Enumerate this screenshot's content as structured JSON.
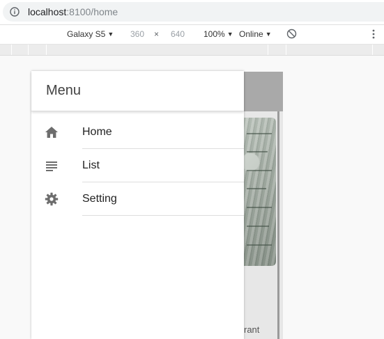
{
  "browser": {
    "url_host": "localhost",
    "url_rest": ":8100/home"
  },
  "device_toolbar": {
    "device": "Galaxy S5",
    "width": "360",
    "separator": "×",
    "height": "640",
    "zoom": "100%",
    "network": "Online"
  },
  "menu": {
    "title": "Menu",
    "items": [
      {
        "label": "Home",
        "icon": "home-icon"
      },
      {
        "label": "List",
        "icon": "list-icon"
      },
      {
        "label": "Setting",
        "icon": "settings-icon"
      }
    ]
  },
  "background_page": {
    "partial_text": "rant"
  },
  "colors": {
    "icon": "#6d6d6d",
    "header_gray": "#a9a9a9",
    "divider": "#dedede"
  }
}
